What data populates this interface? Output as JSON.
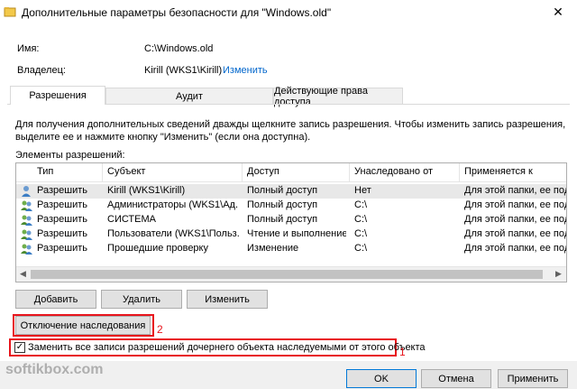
{
  "window": {
    "title": "Дополнительные параметры безопасности  для \"Windows.old\"",
    "close_glyph": "✕"
  },
  "info": {
    "name_label": "Имя:",
    "name_value": "C:\\Windows.old",
    "owner_label": "Владелец:",
    "owner_value": "Kirill (WKS1\\Kirill)",
    "owner_change_link": "Изменить"
  },
  "tabs": [
    {
      "label": "Разрешения",
      "active": true
    },
    {
      "label": "Аудит",
      "active": false
    },
    {
      "label": "Действующие права доступа",
      "active": false
    }
  ],
  "description": "Для получения дополнительных сведений дважды щелкните запись разрешения. Чтобы изменить запись разрешения, выделите ее и нажмите кнопку \"Изменить\" (если она доступна).",
  "permissions": {
    "heading": "Элементы разрешений:",
    "columns": [
      "Тип",
      "Субъект",
      "Доступ",
      "Унаследовано от",
      "Применяется к"
    ],
    "rows": [
      {
        "icon": "single-user-icon",
        "type": "Разрешить",
        "subject": "Kirill (WKS1\\Kirill)",
        "access": "Полный доступ",
        "inherited": "Нет",
        "applies": "Для этой папки, ее подп"
      },
      {
        "icon": "user-group-icon",
        "type": "Разрешить",
        "subject": "Администраторы (WKS1\\Ад...",
        "access": "Полный доступ",
        "inherited": "C:\\",
        "applies": "Для этой папки, ее подп"
      },
      {
        "icon": "user-group-icon",
        "type": "Разрешить",
        "subject": "СИСТЕМА",
        "access": "Полный доступ",
        "inherited": "C:\\",
        "applies": "Для этой папки, ее подп"
      },
      {
        "icon": "user-group-icon",
        "type": "Разрешить",
        "subject": "Пользователи (WKS1\\Польз...",
        "access": "Чтение и выполнение",
        "inherited": "C:\\",
        "applies": "Для этой папки, ее подп"
      },
      {
        "icon": "user-group-icon",
        "type": "Разрешить",
        "subject": "Прошедшие проверку",
        "access": "Изменение",
        "inherited": "C:\\",
        "applies": "Для этой папки, ее подп"
      }
    ]
  },
  "buttons": {
    "add": "Добавить",
    "remove": "Удалить",
    "change": "Изменить",
    "disable_inheritance": "Отключение наследования",
    "ok": "OK",
    "cancel": "Отмена",
    "apply": "Применить"
  },
  "replace_checkbox": {
    "label": "Заменить все записи разрешений дочернего объекта наследуемыми от этого объекта",
    "checked": true,
    "check_glyph": "✓"
  },
  "annotations": {
    "marker_1": "1",
    "marker_2": "2"
  },
  "watermark": "softikbox.com",
  "colors": {
    "accent": "#0078d7",
    "highlight": "#e8141c",
    "link": "#0066cc"
  }
}
